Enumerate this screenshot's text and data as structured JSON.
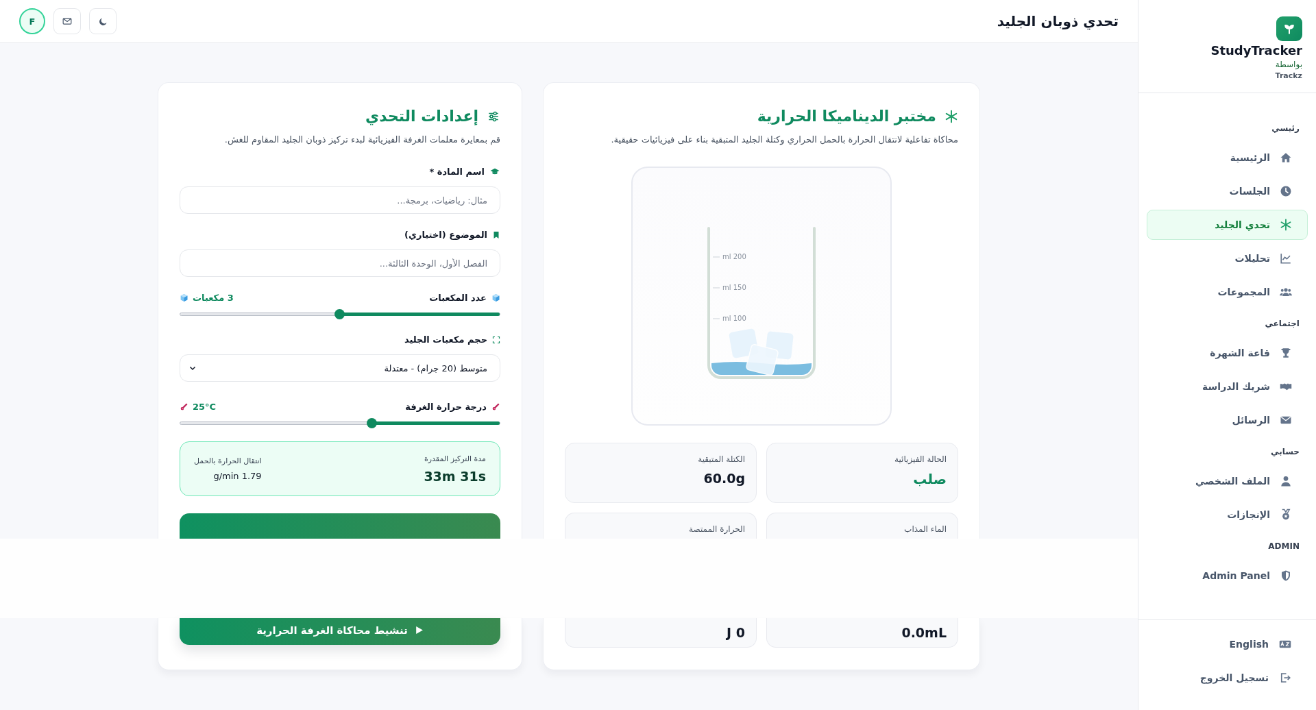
{
  "sidebar": {
    "logo": {
      "name": "StudyTracker",
      "by": "بواسطة",
      "brand": "Trackz"
    },
    "sections": [
      {
        "title": "رئيسي",
        "items": [
          {
            "label": "الرئيسية",
            "selected": false
          },
          {
            "label": "الجلسات",
            "selected": false
          },
          {
            "label": "تحدي الجليد",
            "selected": true
          },
          {
            "label": "تحليلات",
            "selected": false
          },
          {
            "label": "المجموعات",
            "selected": false
          }
        ]
      },
      {
        "title": "اجتماعي",
        "items": [
          {
            "label": "قاعة الشهرة",
            "selected": false
          },
          {
            "label": "شريك الدراسة",
            "selected": false
          },
          {
            "label": "الرسائل",
            "selected": false
          }
        ]
      },
      {
        "title": "حسابي",
        "items": [
          {
            "label": "الملف الشخصي",
            "selected": false
          },
          {
            "label": "الإنجازات",
            "selected": false
          }
        ]
      },
      {
        "title": "ADMIN",
        "items": [
          {
            "label": "Admin Panel",
            "selected": false
          }
        ]
      }
    ],
    "footer": [
      "English",
      "تسجيل الخروج"
    ]
  },
  "topbar": {
    "title": "تحدي ذوبان الجليد",
    "avatar": "F"
  },
  "lab": {
    "title": "مختبر الديناميكا الحرارية",
    "description": "محاكاة تفاعلية لانتقال الحرارة بالحمل الحراري وكتلة الجليد المتبقية بناء على فيزيائيات حقيقية.",
    "beaker": {
      "marks": [
        "ml 200",
        "ml 150",
        "ml 100"
      ]
    },
    "stats": [
      {
        "label": "الحالة الفيزيائية",
        "value": "صلب",
        "kind": "state"
      },
      {
        "label": "الكتلة المتبقية",
        "value": "60.0g",
        "kind": "measure"
      },
      {
        "label": "الماء المذاب",
        "value": "0.0mL",
        "kind": "measure"
      },
      {
        "label": "الحرارة الممتصة",
        "value": "J 0",
        "kind": "measure"
      }
    ]
  },
  "settings": {
    "title": "إعدادات التحدي",
    "description": "قم بمعايرة معلمات الغرفة الفيزيائية لبدء تركيز ذوبان الجليد المقاوم للغش.",
    "subject": {
      "label": "اسم المادة *",
      "placeholder": "مثال: رياضيات، برمجة..."
    },
    "topic": {
      "label": "الموضوع (اختياري)",
      "placeholder": "الفصل الأول، الوحدة الثالثة..."
    },
    "cubes": {
      "label": "عدد المكعبات",
      "reading": "3 مكعبات",
      "level": 0.5
    },
    "size": {
      "label": "حجم مكعبات الجليد",
      "value": "متوسط (20 جرام) - معتدلة"
    },
    "temperature": {
      "label": "درجة حرارة الغرفة",
      "reading": "25°C",
      "level": 0.4
    },
    "summary": [
      {
        "label": "مدة التركيز المقدرة",
        "value": "33m 31s"
      },
      {
        "label": "انتقال الحرارة بالحمل",
        "value": "g/min 1.79"
      }
    ],
    "button": "تنشيط محاكاة الغرفة الحرارية"
  }
}
